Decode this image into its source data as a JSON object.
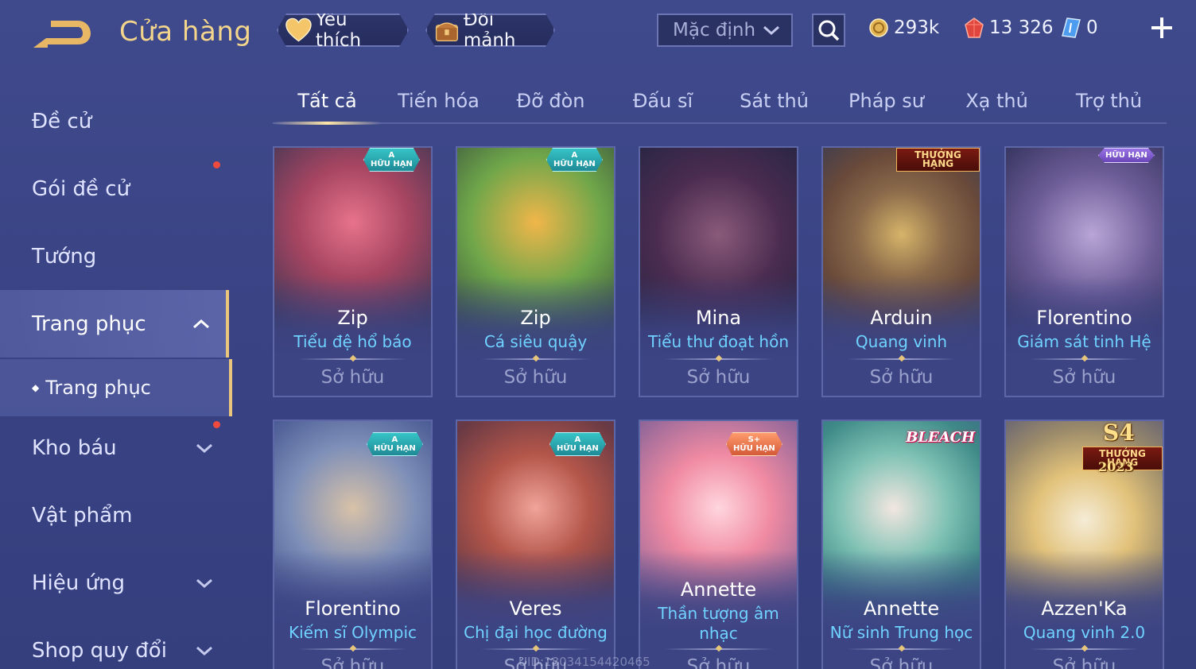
{
  "header": {
    "title": "Cửa hàng",
    "favorites_label": "Yêu thích",
    "shard_exchange_label": "Đổi mảnh",
    "sort_value": "Mặc định",
    "gold": "293k",
    "gems": "13 326",
    "vouchers": "0"
  },
  "sidebar": {
    "items": [
      {
        "label": "Đề cử"
      },
      {
        "label": "Gói đề cử"
      },
      {
        "label": "Tướng"
      },
      {
        "label": "Trang phục"
      },
      {
        "label": "Kho báu"
      },
      {
        "label": "Vật phẩm"
      },
      {
        "label": "Hiệu ứng"
      },
      {
        "label": "Shop quy đổi"
      }
    ],
    "sub_item": "Trang phục"
  },
  "tabs": [
    "Tất cả",
    "Tiến hóa",
    "Đỡ đòn",
    "Đấu sĩ",
    "Sát thủ",
    "Pháp sư",
    "Xạ thủ",
    "Trợ thủ"
  ],
  "cards": [
    {
      "hero": "Zip",
      "skin": "Tiểu đệ hổ báo",
      "status": "Sở hữu",
      "badge": "HỮU HẠN",
      "tier": "A"
    },
    {
      "hero": "Zip",
      "skin": "Cá siêu quậy",
      "status": "Sở hữu",
      "badge": "HỮU HẠN",
      "tier": "A"
    },
    {
      "hero": "Mina",
      "skin": "Tiểu thư đoạt hồn",
      "status": "Sở hữu"
    },
    {
      "hero": "Arduin",
      "skin": "Quang vinh",
      "status": "Sở hữu",
      "badge": "THƯỞNG HẠNG"
    },
    {
      "hero": "Florentino",
      "skin": "Giám sát tinh Hệ",
      "status": "Sở hữu",
      "badge": "HỮU HẠN"
    },
    {
      "hero": "Florentino",
      "skin": "Kiếm sĩ Olympic",
      "status": "Sở hữu",
      "badge": "HỮU HẠN",
      "tier": "A"
    },
    {
      "hero": "Veres",
      "skin": "Chị đại học đường",
      "status": "Sở hữu",
      "badge": "HỮU HẠN",
      "tier": "A"
    },
    {
      "hero": "Annette",
      "skin": "Thần tượng âm nhạc",
      "status": "Sở hữu",
      "badge": "HỮU HẠN",
      "tier": "S+"
    },
    {
      "hero": "Annette",
      "skin": "Nữ sinh Trung học",
      "status": "Sở hữu",
      "collab": "BLEACH"
    },
    {
      "hero": "Azzen'Ka",
      "skin": "Quang vinh 2.0",
      "status": "Sở hữu",
      "season": "S4",
      "badge": "THƯỞNG HẠNG",
      "year": "2023"
    }
  ],
  "watermark": "UID:18034154420465",
  "colors": {
    "accent_gold": "#e9c67b",
    "skin_name": "#6fd2ff",
    "background": "#3f4a8c",
    "red_dot": "#ee4a3d"
  }
}
